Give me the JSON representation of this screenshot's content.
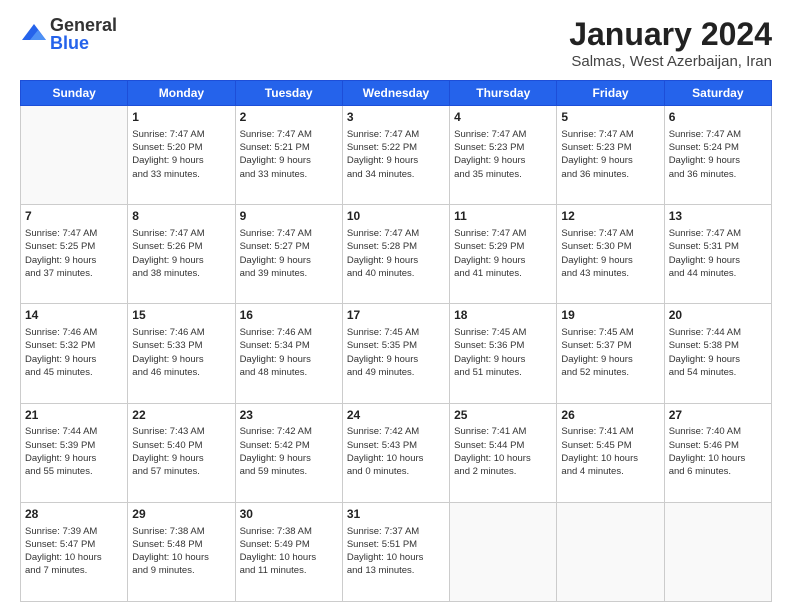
{
  "logo": {
    "general": "General",
    "blue": "Blue"
  },
  "header": {
    "title": "January 2024",
    "subtitle": "Salmas, West Azerbaijan, Iran"
  },
  "weekdays": [
    "Sunday",
    "Monday",
    "Tuesday",
    "Wednesday",
    "Thursday",
    "Friday",
    "Saturday"
  ],
  "weeks": [
    [
      {
        "day": "",
        "lines": []
      },
      {
        "day": "1",
        "lines": [
          "Sunrise: 7:47 AM",
          "Sunset: 5:20 PM",
          "Daylight: 9 hours",
          "and 33 minutes."
        ]
      },
      {
        "day": "2",
        "lines": [
          "Sunrise: 7:47 AM",
          "Sunset: 5:21 PM",
          "Daylight: 9 hours",
          "and 33 minutes."
        ]
      },
      {
        "day": "3",
        "lines": [
          "Sunrise: 7:47 AM",
          "Sunset: 5:22 PM",
          "Daylight: 9 hours",
          "and 34 minutes."
        ]
      },
      {
        "day": "4",
        "lines": [
          "Sunrise: 7:47 AM",
          "Sunset: 5:23 PM",
          "Daylight: 9 hours",
          "and 35 minutes."
        ]
      },
      {
        "day": "5",
        "lines": [
          "Sunrise: 7:47 AM",
          "Sunset: 5:23 PM",
          "Daylight: 9 hours",
          "and 36 minutes."
        ]
      },
      {
        "day": "6",
        "lines": [
          "Sunrise: 7:47 AM",
          "Sunset: 5:24 PM",
          "Daylight: 9 hours",
          "and 36 minutes."
        ]
      }
    ],
    [
      {
        "day": "7",
        "lines": [
          "Sunrise: 7:47 AM",
          "Sunset: 5:25 PM",
          "Daylight: 9 hours",
          "and 37 minutes."
        ]
      },
      {
        "day": "8",
        "lines": [
          "Sunrise: 7:47 AM",
          "Sunset: 5:26 PM",
          "Daylight: 9 hours",
          "and 38 minutes."
        ]
      },
      {
        "day": "9",
        "lines": [
          "Sunrise: 7:47 AM",
          "Sunset: 5:27 PM",
          "Daylight: 9 hours",
          "and 39 minutes."
        ]
      },
      {
        "day": "10",
        "lines": [
          "Sunrise: 7:47 AM",
          "Sunset: 5:28 PM",
          "Daylight: 9 hours",
          "and 40 minutes."
        ]
      },
      {
        "day": "11",
        "lines": [
          "Sunrise: 7:47 AM",
          "Sunset: 5:29 PM",
          "Daylight: 9 hours",
          "and 41 minutes."
        ]
      },
      {
        "day": "12",
        "lines": [
          "Sunrise: 7:47 AM",
          "Sunset: 5:30 PM",
          "Daylight: 9 hours",
          "and 43 minutes."
        ]
      },
      {
        "day": "13",
        "lines": [
          "Sunrise: 7:47 AM",
          "Sunset: 5:31 PM",
          "Daylight: 9 hours",
          "and 44 minutes."
        ]
      }
    ],
    [
      {
        "day": "14",
        "lines": [
          "Sunrise: 7:46 AM",
          "Sunset: 5:32 PM",
          "Daylight: 9 hours",
          "and 45 minutes."
        ]
      },
      {
        "day": "15",
        "lines": [
          "Sunrise: 7:46 AM",
          "Sunset: 5:33 PM",
          "Daylight: 9 hours",
          "and 46 minutes."
        ]
      },
      {
        "day": "16",
        "lines": [
          "Sunrise: 7:46 AM",
          "Sunset: 5:34 PM",
          "Daylight: 9 hours",
          "and 48 minutes."
        ]
      },
      {
        "day": "17",
        "lines": [
          "Sunrise: 7:45 AM",
          "Sunset: 5:35 PM",
          "Daylight: 9 hours",
          "and 49 minutes."
        ]
      },
      {
        "day": "18",
        "lines": [
          "Sunrise: 7:45 AM",
          "Sunset: 5:36 PM",
          "Daylight: 9 hours",
          "and 51 minutes."
        ]
      },
      {
        "day": "19",
        "lines": [
          "Sunrise: 7:45 AM",
          "Sunset: 5:37 PM",
          "Daylight: 9 hours",
          "and 52 minutes."
        ]
      },
      {
        "day": "20",
        "lines": [
          "Sunrise: 7:44 AM",
          "Sunset: 5:38 PM",
          "Daylight: 9 hours",
          "and 54 minutes."
        ]
      }
    ],
    [
      {
        "day": "21",
        "lines": [
          "Sunrise: 7:44 AM",
          "Sunset: 5:39 PM",
          "Daylight: 9 hours",
          "and 55 minutes."
        ]
      },
      {
        "day": "22",
        "lines": [
          "Sunrise: 7:43 AM",
          "Sunset: 5:40 PM",
          "Daylight: 9 hours",
          "and 57 minutes."
        ]
      },
      {
        "day": "23",
        "lines": [
          "Sunrise: 7:42 AM",
          "Sunset: 5:42 PM",
          "Daylight: 9 hours",
          "and 59 minutes."
        ]
      },
      {
        "day": "24",
        "lines": [
          "Sunrise: 7:42 AM",
          "Sunset: 5:43 PM",
          "Daylight: 10 hours",
          "and 0 minutes."
        ]
      },
      {
        "day": "25",
        "lines": [
          "Sunrise: 7:41 AM",
          "Sunset: 5:44 PM",
          "Daylight: 10 hours",
          "and 2 minutes."
        ]
      },
      {
        "day": "26",
        "lines": [
          "Sunrise: 7:41 AM",
          "Sunset: 5:45 PM",
          "Daylight: 10 hours",
          "and 4 minutes."
        ]
      },
      {
        "day": "27",
        "lines": [
          "Sunrise: 7:40 AM",
          "Sunset: 5:46 PM",
          "Daylight: 10 hours",
          "and 6 minutes."
        ]
      }
    ],
    [
      {
        "day": "28",
        "lines": [
          "Sunrise: 7:39 AM",
          "Sunset: 5:47 PM",
          "Daylight: 10 hours",
          "and 7 minutes."
        ]
      },
      {
        "day": "29",
        "lines": [
          "Sunrise: 7:38 AM",
          "Sunset: 5:48 PM",
          "Daylight: 10 hours",
          "and 9 minutes."
        ]
      },
      {
        "day": "30",
        "lines": [
          "Sunrise: 7:38 AM",
          "Sunset: 5:49 PM",
          "Daylight: 10 hours",
          "and 11 minutes."
        ]
      },
      {
        "day": "31",
        "lines": [
          "Sunrise: 7:37 AM",
          "Sunset: 5:51 PM",
          "Daylight: 10 hours",
          "and 13 minutes."
        ]
      },
      {
        "day": "",
        "lines": []
      },
      {
        "day": "",
        "lines": []
      },
      {
        "day": "",
        "lines": []
      }
    ]
  ]
}
